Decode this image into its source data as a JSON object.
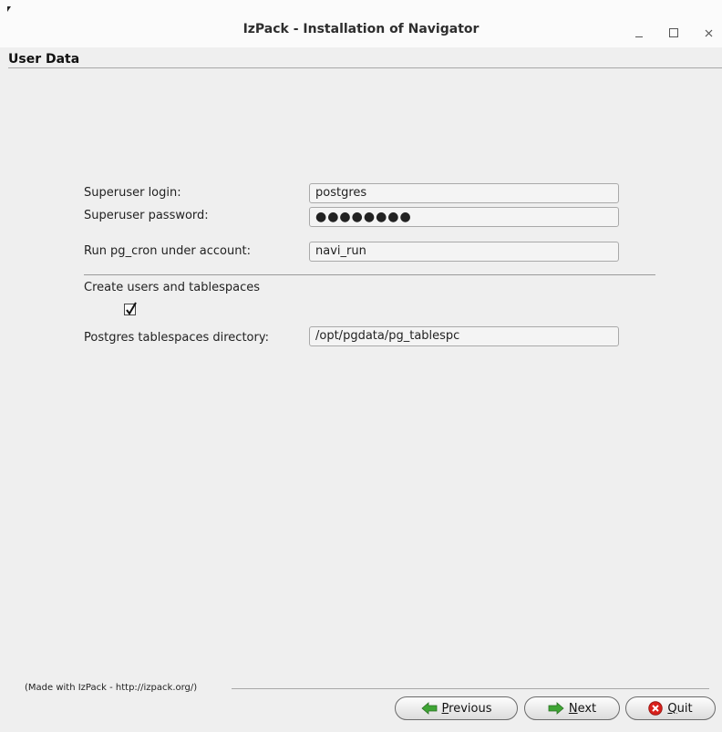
{
  "window": {
    "title": "IzPack - Installation of Navigator"
  },
  "panel": {
    "title": "User Data"
  },
  "form": {
    "superuser_login_label": "Superuser login:",
    "superuser_login_value": "postgres",
    "superuser_password_label": "Superuser password:",
    "superuser_password_value": "●●●●●●●●",
    "pg_cron_account_label": "Run pg_cron under account:",
    "pg_cron_account_value": "navi_run",
    "create_users_label": "Create users and tablespaces",
    "create_users_checked": true,
    "tablespaces_dir_label": "Postgres tablespaces directory:",
    "tablespaces_dir_value": "/opt/pgdata/pg_tablespc"
  },
  "footer": {
    "made_with": "(Made with IzPack - http://izpack.org/)",
    "previous_mnemonic": "P",
    "previous_rest": "revious",
    "next_mnemonic": "N",
    "next_rest": "ext",
    "quit_mnemonic": "Q",
    "quit_rest": "uit"
  },
  "icons": {
    "previous": "green-left-arrow-icon",
    "next": "green-right-arrow-icon",
    "quit": "red-x-circle-icon"
  },
  "colors": {
    "arrow_green": "#3fa535",
    "quit_red": "#d8201b"
  }
}
